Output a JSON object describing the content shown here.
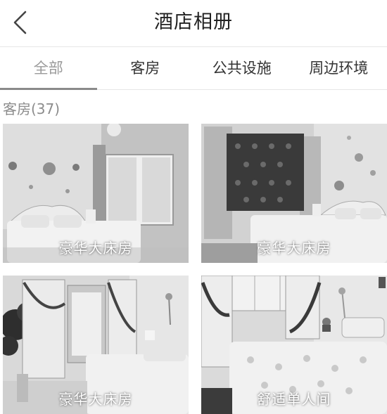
{
  "header": {
    "title": "酒店相册"
  },
  "tabs": [
    {
      "label": "全部",
      "active": true
    },
    {
      "label": "客房",
      "active": false
    },
    {
      "label": "公共设施",
      "active": false
    },
    {
      "label": "周边环境",
      "active": false
    }
  ],
  "section": {
    "label": "客房(37)"
  },
  "photos": [
    {
      "caption": "豪华大床房"
    },
    {
      "caption": "豪华大床房"
    },
    {
      "caption": "豪华大床房"
    },
    {
      "caption": "舒适单人间"
    }
  ],
  "colors": {
    "active_tab": "#9a9a9a",
    "active_underline": "#8a8a8a",
    "section_label": "#8c8c8c"
  }
}
